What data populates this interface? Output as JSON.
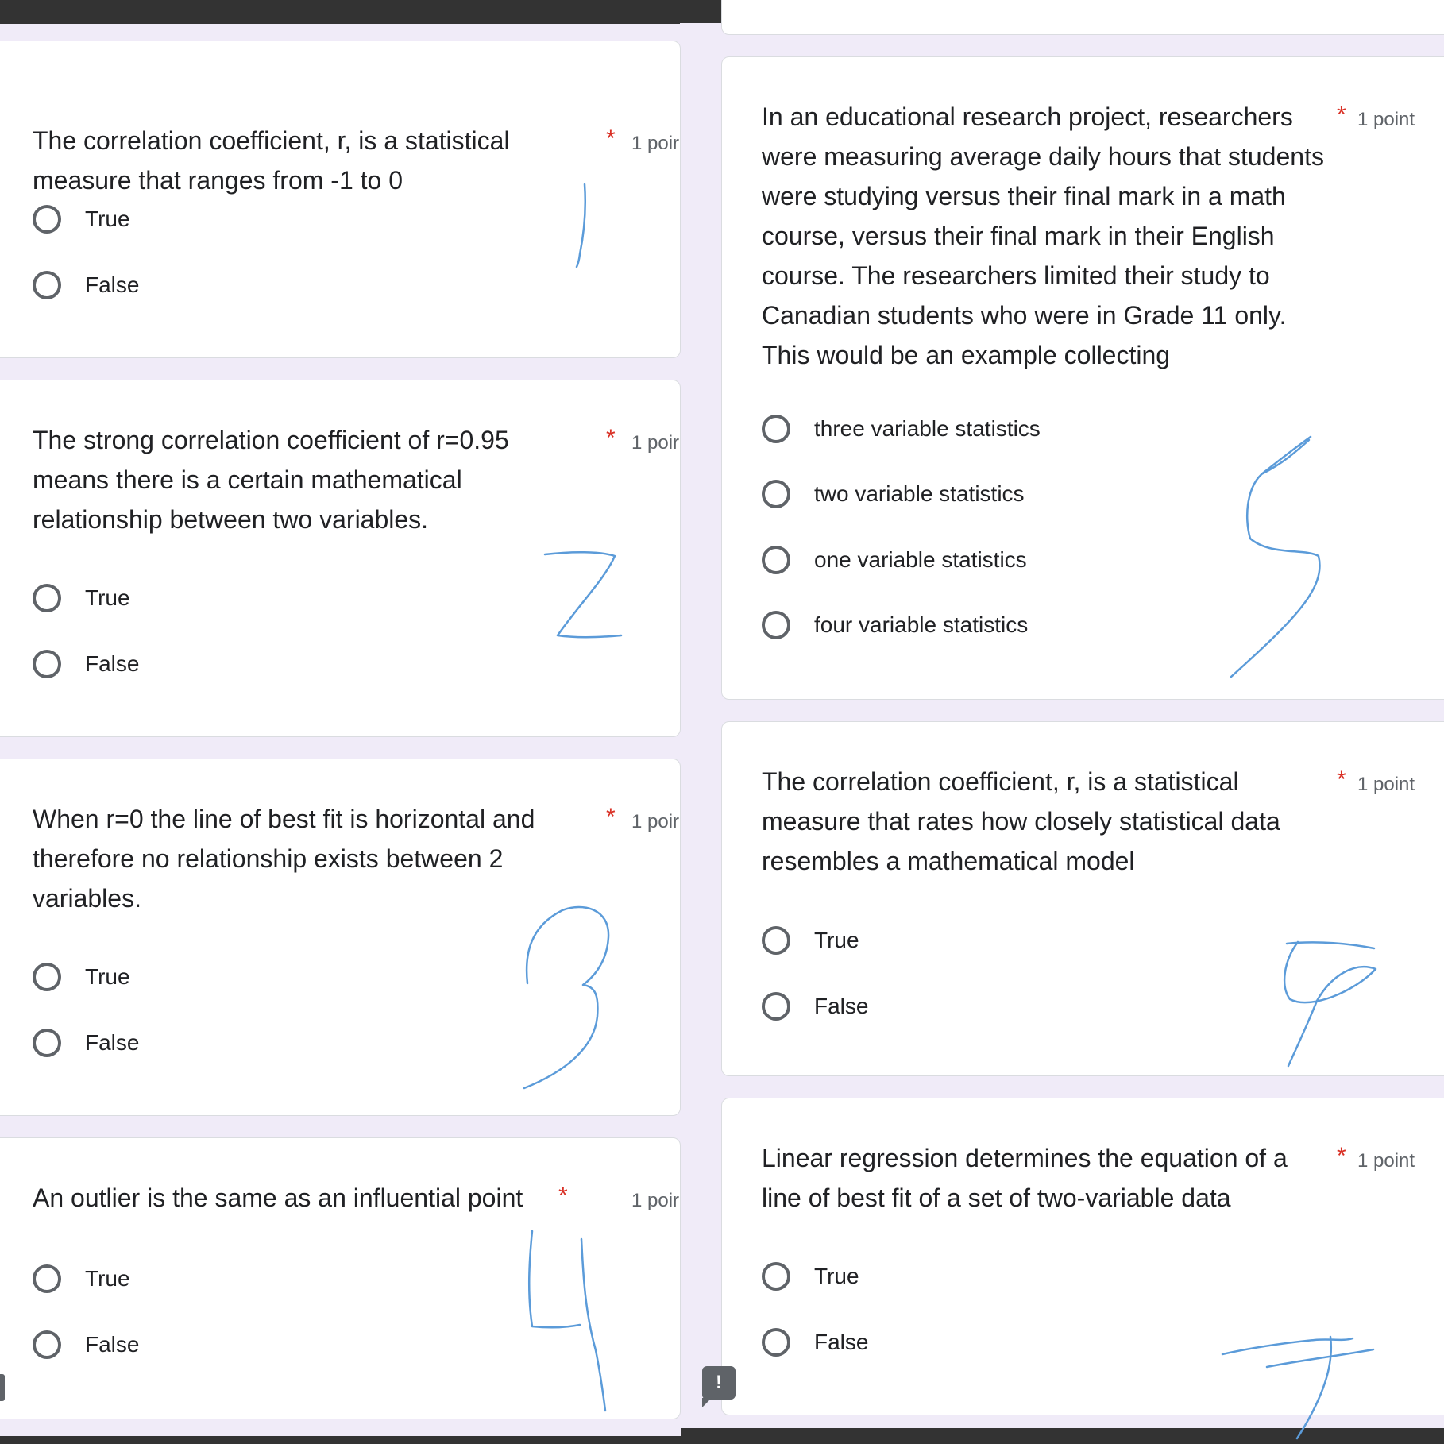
{
  "questions": [
    {
      "text": "The correlation coefficient, r,  is a statistical measure that ranges from -1  to 0",
      "required": "*",
      "points": "1 poir",
      "options": [
        "True",
        "False"
      ]
    },
    {
      "text": "The strong correlation coefficient of r=0.95 means there is a certain mathematical relationship between two variables.",
      "required": "*",
      "points": "1 poir",
      "options": [
        "True",
        "False"
      ]
    },
    {
      "text": "When r=0  the line of best fit is horizontal and therefore no relationship exists between 2 variables.",
      "required": "*",
      "points": "1 poir",
      "options": [
        "True",
        "False"
      ]
    },
    {
      "text": "An outlier is the same as an influential point",
      "required": "*",
      "points": "1 poir",
      "options": [
        "True",
        "False"
      ]
    },
    {
      "text": "In an educational research project, researchers were measuring average daily hours that students were studying versus their final mark in a math course, versus their final mark in their English course. The researchers limited their study to Canadian students who were in Grade 11 only. This would be an example collecting",
      "required": "*",
      "points": "1 point",
      "options": [
        "three variable statistics",
        "two variable statistics",
        "one variable statistics",
        "four variable statistics"
      ]
    },
    {
      "text": "The correlation coefficient, r, is a statistical measure that rates how closely statistical data resembles a mathematical model",
      "required": "*",
      "points": "1 point",
      "options": [
        "True",
        "False"
      ]
    },
    {
      "text": "Linear regression determines the equation of a line of best fit of a set of two-variable data",
      "required": "*",
      "points": "1 point",
      "options": [
        "True",
        "False"
      ]
    }
  ],
  "handwritten_numbers": [
    "1",
    "2",
    "3",
    "4",
    "5",
    "6",
    "7"
  ],
  "feedback_icon": "exclamation-feedback-icon",
  "colors": {
    "background": "#f0ebf8",
    "required": "#d93025",
    "ink": "#5b9bd9"
  }
}
